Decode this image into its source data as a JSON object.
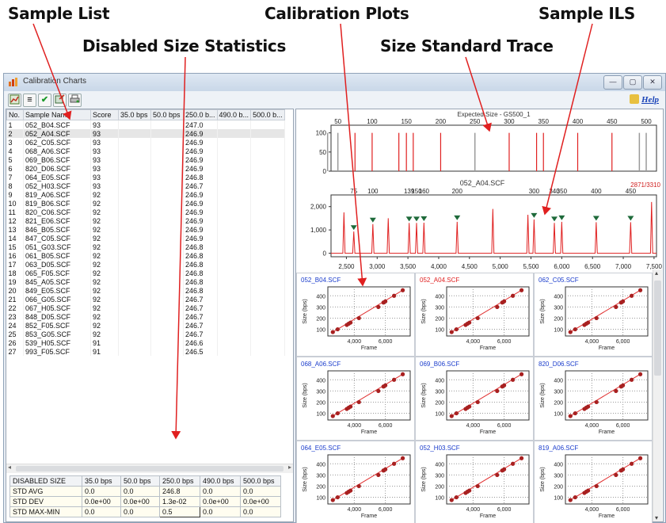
{
  "callouts": {
    "sample_list": "Sample List",
    "calibration_plots": "Calibration Plots",
    "sample_ils": "Sample ILS",
    "disabled_size_statistics": "Disabled Size Statistics",
    "size_standard_trace": "Size Standard Trace"
  },
  "window": {
    "title": "Calibration Charts",
    "help_label": "Help",
    "controls": [
      "—",
      "▢",
      "✕"
    ]
  },
  "toolbar": {
    "icons": [
      "chart-icon",
      "list-icon",
      "check-icon",
      "export-icon",
      "print-icon"
    ]
  },
  "sample_table": {
    "columns": [
      "No.",
      "Sample Name",
      "Score",
      "35.0 bps",
      "50.0 bps",
      "250.0 b...",
      "490.0 b...",
      "500.0 b..."
    ],
    "rows": [
      [
        "1",
        "052_B04.SCF",
        "93",
        "",
        "",
        "247.0",
        "",
        ""
      ],
      [
        "2",
        "052_A04.SCF",
        "93",
        "",
        "",
        "246.9",
        "",
        ""
      ],
      [
        "3",
        "062_C05.SCF",
        "93",
        "",
        "",
        "246.9",
        "",
        ""
      ],
      [
        "4",
        "068_A06.SCF",
        "93",
        "",
        "",
        "246.9",
        "",
        ""
      ],
      [
        "5",
        "069_B06.SCF",
        "93",
        "",
        "",
        "246.9",
        "",
        ""
      ],
      [
        "6",
        "820_D06.SCF",
        "93",
        "",
        "",
        "246.9",
        "",
        ""
      ],
      [
        "7",
        "064_E05.SCF",
        "93",
        "",
        "",
        "246.8",
        "",
        ""
      ],
      [
        "8",
        "052_H03.SCF",
        "93",
        "",
        "",
        "246.7",
        "",
        ""
      ],
      [
        "9",
        "819_A06.SCF",
        "92",
        "",
        "",
        "246.9",
        "",
        ""
      ],
      [
        "10",
        "819_B06.SCF",
        "92",
        "",
        "",
        "246.9",
        "",
        ""
      ],
      [
        "11",
        "820_C06.SCF",
        "92",
        "",
        "",
        "246.9",
        "",
        ""
      ],
      [
        "12",
        "821_E06.SCF",
        "92",
        "",
        "",
        "246.9",
        "",
        ""
      ],
      [
        "13",
        "846_B05.SCF",
        "92",
        "",
        "",
        "246.9",
        "",
        ""
      ],
      [
        "14",
        "847_C05.SCF",
        "92",
        "",
        "",
        "246.9",
        "",
        ""
      ],
      [
        "15",
        "051_G03.SCF",
        "92",
        "",
        "",
        "246.8",
        "",
        ""
      ],
      [
        "16",
        "061_B05.SCF",
        "92",
        "",
        "",
        "246.8",
        "",
        ""
      ],
      [
        "17",
        "063_D05.SCF",
        "92",
        "",
        "",
        "246.8",
        "",
        ""
      ],
      [
        "18",
        "065_F05.SCF",
        "92",
        "",
        "",
        "246.8",
        "",
        ""
      ],
      [
        "19",
        "845_A05.SCF",
        "92",
        "",
        "",
        "246.8",
        "",
        ""
      ],
      [
        "20",
        "849_E05.SCF",
        "92",
        "",
        "",
        "246.8",
        "",
        ""
      ],
      [
        "21",
        "066_G05.SCF",
        "92",
        "",
        "",
        "246.7",
        "",
        ""
      ],
      [
        "22",
        "067_H05.SCF",
        "92",
        "",
        "",
        "246.7",
        "",
        ""
      ],
      [
        "23",
        "848_D05.SCF",
        "92",
        "",
        "",
        "246.7",
        "",
        ""
      ],
      [
        "24",
        "852_F05.SCF",
        "92",
        "",
        "",
        "246.7",
        "",
        ""
      ],
      [
        "25",
        "853_G05.SCF",
        "92",
        "",
        "",
        "246.7",
        "",
        ""
      ],
      [
        "26",
        "539_H05.SCF",
        "91",
        "",
        "",
        "246.6",
        "",
        ""
      ],
      [
        "27",
        "993_F05.SCF",
        "91",
        "",
        "",
        "246.5",
        "",
        ""
      ]
    ]
  },
  "disabled_stats": {
    "header": [
      "DISABLED SIZE",
      "35.0 bps",
      "50.0 bps",
      "250.0 bps",
      "490.0 bps",
      "500.0 bps"
    ],
    "rows": [
      [
        "STD AVG",
        "0.0",
        "0.0",
        "246.8",
        "0.0",
        "0.0"
      ],
      [
        "STD DEV",
        "0.0e+00",
        "0.0e+00",
        "1.3e-02",
        "0.0e+00",
        "0.0e+00"
      ],
      [
        "STD MAX-MIN",
        "0.0",
        "0.0",
        "0.5",
        "0.0",
        "0.0"
      ]
    ]
  },
  "chart_data": [
    {
      "type": "line",
      "title": "Expected Size - GS500_1",
      "x_tick_labels": [
        "50",
        "100",
        "150",
        "200",
        "250",
        "300",
        "350",
        "400",
        "450",
        "500"
      ],
      "x_range": [
        40,
        515
      ],
      "y_ticks": [
        "0",
        "50",
        "100"
      ],
      "ylim": [
        0,
        120
      ],
      "lines_red": [
        75,
        100,
        139,
        150,
        160,
        200,
        300,
        340,
        350,
        400,
        450
      ],
      "lines_gray": [
        35,
        50,
        250,
        490,
        500
      ],
      "colors": {
        "red": "#e02020",
        "gray": "#9a9a9a"
      }
    },
    {
      "type": "line",
      "title": "052_A04.SCF",
      "corner_label": "2871/3310",
      "peak_labels": [
        "75",
        "100",
        "139",
        "150",
        "160",
        "200",
        "300",
        "340",
        "350",
        "400",
        "450"
      ],
      "peak_x": [
        2620,
        2930,
        3520,
        3640,
        3760,
        4300,
        5550,
        5880,
        6000,
        6560,
        7120
      ],
      "peak_heights": [
        930,
        1250,
        1300,
        1300,
        1310,
        1350,
        1450,
        1300,
        1350,
        1330,
        1330
      ],
      "other_peaks_x": [
        2460,
        3180,
        4880,
        5450,
        7460
      ],
      "other_peaks_heights": [
        1750,
        1500,
        1900,
        1650,
        2200
      ],
      "x_tick_labels": [
        "2,500",
        "3,000",
        "3,500",
        "4,000",
        "4,500",
        "5,000",
        "5,500",
        "6,000",
        "6,500",
        "7,000",
        "7,500"
      ],
      "x_range": [
        2250,
        7540
      ],
      "y_tick_labels": [
        "0",
        "1,000",
        "2,000"
      ],
      "ylim": [
        -150,
        2500
      ],
      "colors": {
        "trace": "#e02020",
        "marker": "#1e6a3a"
      }
    },
    {
      "type": "scatter",
      "panels": [
        {
          "name": "052_B04.SCF",
          "color": "#1a3ccc"
        },
        {
          "name": "052_A04.SCF",
          "color": "#e02020"
        },
        {
          "name": "062_C05.SCF",
          "color": "#1a3ccc"
        },
        {
          "name": "068_A06.SCF",
          "color": "#1a3ccc"
        },
        {
          "name": "069_B06.SCF",
          "color": "#1a3ccc"
        },
        {
          "name": "820_D06.SCF",
          "color": "#1a3ccc"
        },
        {
          "name": "064_E05.SCF",
          "color": "#1a3ccc"
        },
        {
          "name": "052_H03.SCF",
          "color": "#1a3ccc"
        },
        {
          "name": "819_A06.SCF",
          "color": "#1a3ccc"
        }
      ],
      "xlabel": "Frame",
      "ylabel": "Size (bps)",
      "x_tick_labels": [
        "4,000",
        "6,000"
      ],
      "xlim": [
        2300,
        7600
      ],
      "y_tick_labels": [
        "100",
        "200",
        "300",
        "400"
      ],
      "ylim": [
        40,
        480
      ],
      "points_x": [
        2620,
        2930,
        3520,
        3640,
        3760,
        4300,
        5550,
        5880,
        6000,
        6560,
        7120
      ],
      "points_y": [
        75,
        100,
        139,
        150,
        160,
        200,
        300,
        340,
        350,
        400,
        450
      ],
      "colors": {
        "points": "#a82020",
        "fit": "#e03030"
      }
    }
  ]
}
